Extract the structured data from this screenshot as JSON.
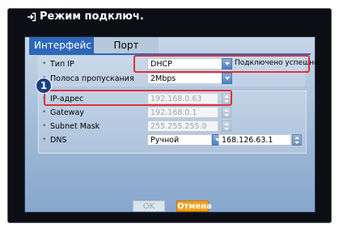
{
  "window": {
    "title": "Режим подключ."
  },
  "tabs": [
    {
      "label": "Интерфейс",
      "active": true
    },
    {
      "label": "Порт",
      "active": false
    }
  ],
  "fields": {
    "ip_type": {
      "label": "Тип IP",
      "value": "DHCP",
      "status": "Подключено успешно."
    },
    "bandwidth": {
      "label": "Полоса пропускания",
      "value": "2Mbps"
    },
    "ip_address": {
      "label": "IP-адрес",
      "value": "192.168.0.63"
    },
    "gateway": {
      "label": "Gateway",
      "value": "192.168.0.1"
    },
    "subnet_mask": {
      "label": "Subnet Mask",
      "value": "255.255.255.0"
    },
    "dns": {
      "label": "DNS",
      "mode": "Ручной",
      "value": "168.126.63.1"
    }
  },
  "annotation": {
    "badge_number": "1"
  },
  "buttons": {
    "ok": "OK",
    "cancel": "Отмена"
  },
  "colors": {
    "accent": "#2e67b9",
    "highlight": "#e0303a",
    "cancel": "#f2a01b"
  }
}
